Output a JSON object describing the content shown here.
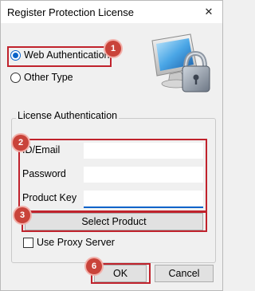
{
  "window": {
    "title": "Register Protection License",
    "close_glyph": "✕"
  },
  "auth_type": {
    "options": [
      {
        "label": "Web Authentication",
        "selected": true
      },
      {
        "label": "Other Type",
        "selected": false
      }
    ]
  },
  "license_group": {
    "legend": "License Authentication",
    "fields": [
      {
        "label": "ID/Email",
        "value": ""
      },
      {
        "label": "Password",
        "value": ""
      },
      {
        "label": "Product Key",
        "value": ""
      }
    ],
    "select_product_label": "Select Product",
    "use_proxy_label": "Use Proxy Server",
    "use_proxy_checked": false
  },
  "buttons": {
    "ok": "OK",
    "cancel": "Cancel"
  },
  "annotations": [
    "1",
    "2",
    "3",
    "6"
  ],
  "colors": {
    "annotation": "#c0222c",
    "badge": "#c9433a",
    "accent": "#0a63c9",
    "background": "#f0f0f0"
  },
  "icons": {
    "logo": "computer-with-padlock-icon"
  }
}
